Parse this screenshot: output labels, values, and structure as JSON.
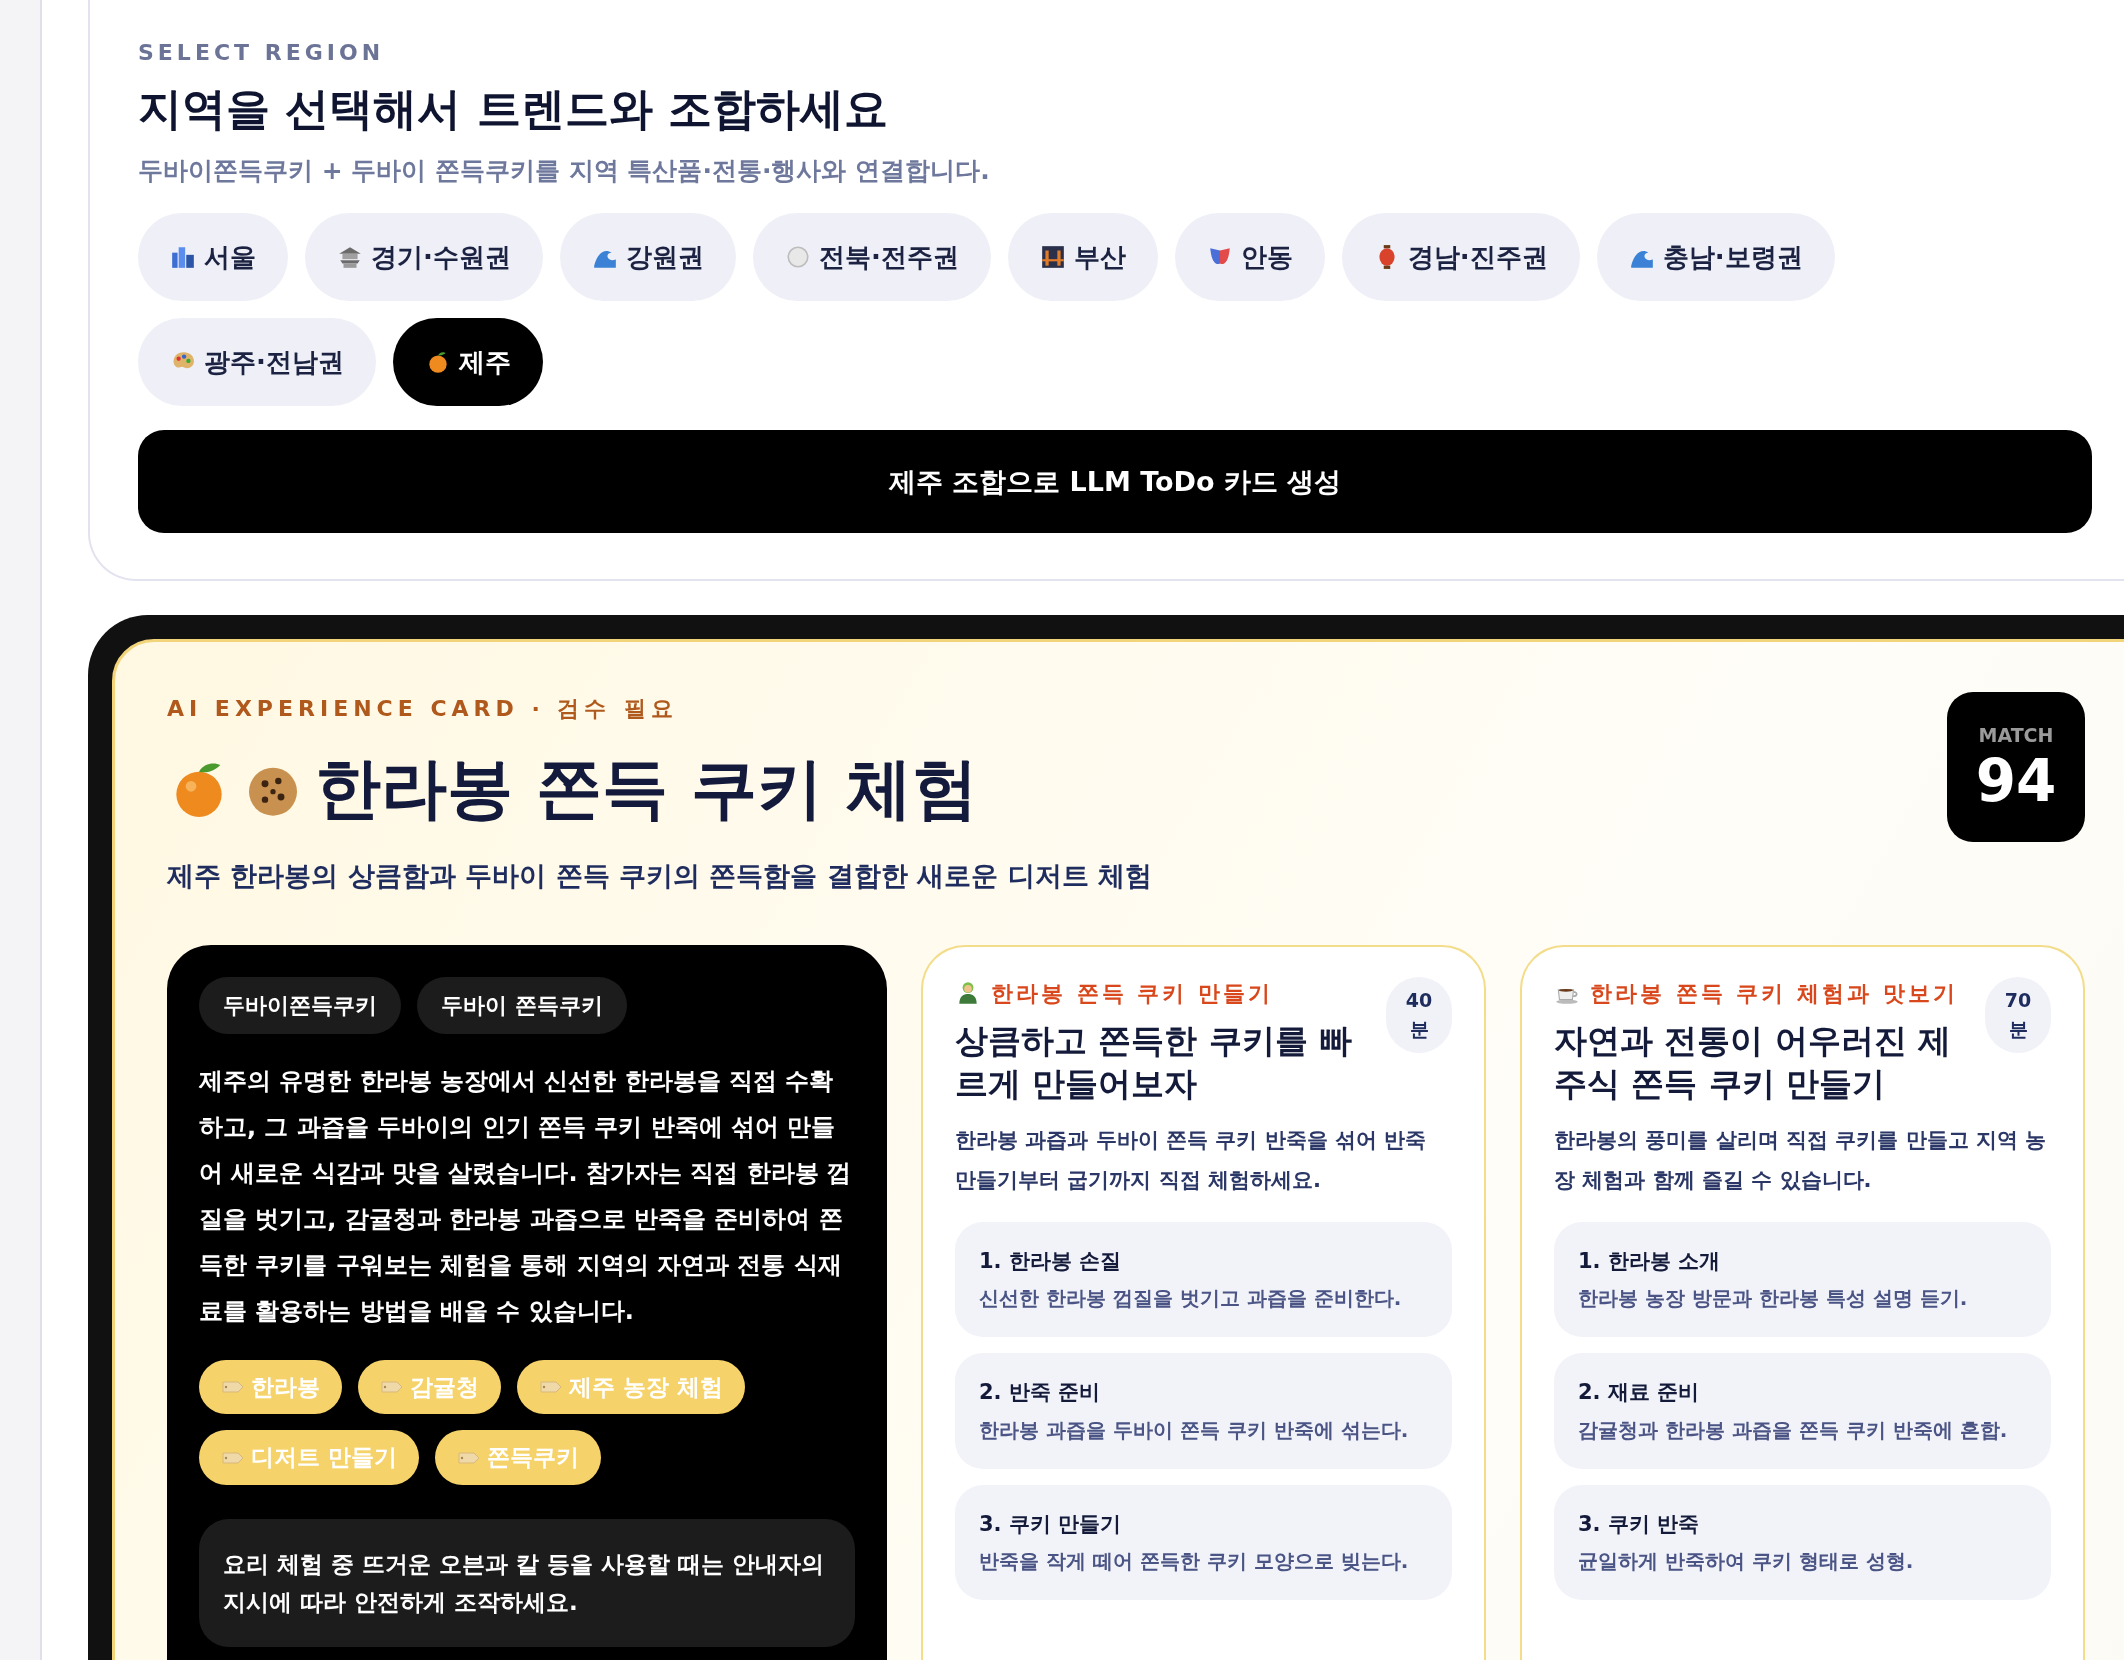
{
  "section": {
    "eyebrow": "SELECT REGION",
    "title": "지역을 선택해서 트렌드와 조합하세요",
    "subtitle": "두바이쫀득쿠키 + 두바이 쫀득쿠키를 지역 특산품·전통·행사와 연결합니다."
  },
  "regions": [
    {
      "label": "서울",
      "selected": false
    },
    {
      "label": "경기·수원권",
      "selected": false
    },
    {
      "label": "강원권",
      "selected": false
    },
    {
      "label": "전북·전주권",
      "selected": false
    },
    {
      "label": "부산",
      "selected": false
    },
    {
      "label": "안동",
      "selected": false
    },
    {
      "label": "경남·진주권",
      "selected": false
    },
    {
      "label": "충남·보령권",
      "selected": false
    },
    {
      "label": "광주·전남권",
      "selected": false
    },
    {
      "label": "제주",
      "selected": true
    }
  ],
  "generate_button": "제주 조합으로 LLM ToDo 카드 생성",
  "card": {
    "eyebrow": "AI EXPERIENCE CARD · 검수 필요",
    "title": "한라봉 쫀득 쿠키 체험",
    "subtitle": "제주 한라봉의 상큼함과 두바이 쫀득 쿠키의 쫀득함을 결합한 새로운 디저트 체험",
    "match_label": "MATCH",
    "match_score": "94",
    "keywords": [
      "두바이쫀득쿠키",
      "두바이 쫀득쿠키"
    ],
    "description": "제주의 유명한 한라봉 농장에서 신선한 한라봉을 직접 수확하고, 그 과즙을 두바이의 인기 쫀득 쿠키 반죽에 섞어 만들어 새로운 식감과 맛을 살렸습니다. 참가자는 직접 한라봉 껍질을 벗기고, 감귤청과 한라봉 과즙으로 반죽을 준비하여 쫀득한 쿠키를 구워보는 체험을 통해 지역의 자연과 전통 식재료를 활용하는 방법을 배울 수 있습니다.",
    "tags": [
      "한라봉",
      "감귤청",
      "제주 농장 체험",
      "디저트 만들기",
      "쫀득쿠키"
    ],
    "safety_note": "요리 체험 중 뜨거운 오븐과 칼 등을 사용할 때는 안내자의 지시에 따라 안전하게 조작하세요.",
    "experiences": [
      {
        "category": "한라봉 쫀득 쿠키 만들기",
        "title": "상큼하고 쫀득한 쿠키를 빠르게 만들어보자",
        "duration": "40",
        "duration_unit": "분",
        "description": "한라봉 과즙과 두바이 쫀득 쿠키 반죽을 섞어 반죽 만들기부터 굽기까지 직접 체험하세요.",
        "steps": [
          {
            "title": "1. 한라봉 손질",
            "text": "신선한 한라봉 껍질을 벗기고 과즙을 준비한다."
          },
          {
            "title": "2. 반죽 준비",
            "text": "한라봉 과즙을 두바이 쫀득 쿠키 반죽에 섞는다."
          },
          {
            "title": "3. 쿠키 만들기",
            "text": "반죽을 작게 떼어 쫀득한 쿠키 모양으로 빚는다."
          }
        ]
      },
      {
        "category": "한라봉 쫀득 쿠키 체험과 맛보기",
        "title": "자연과 전통이 어우러진 제주식 쫀득 쿠키 만들기",
        "duration": "70",
        "duration_unit": "분",
        "description": "한라봉의 풍미를 살리며 직접 쿠키를 만들고 지역 농장 체험과 함께 즐길 수 있습니다.",
        "steps": [
          {
            "title": "1. 한라봉 소개",
            "text": "한라봉 농장 방문과 한라봉 특성 설명 듣기."
          },
          {
            "title": "2. 재료 준비",
            "text": "감귤청과 한라봉 과즙을 쫀득 쿠키 반죽에 혼합."
          },
          {
            "title": "3. 쿠키 반죽",
            "text": "균일하게 반죽하여 쿠키 형태로 성형."
          }
        ]
      }
    ]
  }
}
